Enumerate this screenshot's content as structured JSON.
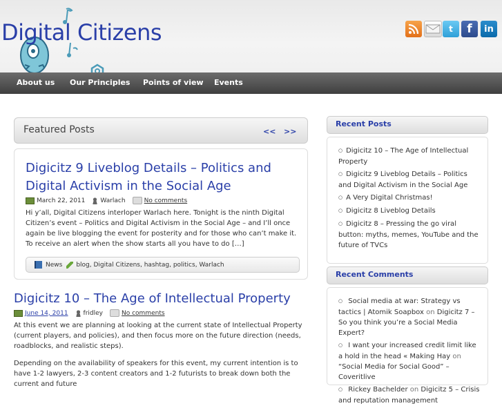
{
  "site": {
    "title": "Digital Citizens"
  },
  "social": [
    {
      "name": "rss-icon",
      "glyph": ""
    },
    {
      "name": "email-icon",
      "glyph": ""
    },
    {
      "name": "twitter-icon",
      "glyph": "t"
    },
    {
      "name": "facebook-icon",
      "glyph": "f"
    },
    {
      "name": "linkedin-icon",
      "glyph": "in"
    }
  ],
  "nav": [
    "About us",
    "Our Principles",
    "Points of view",
    "Events"
  ],
  "featured": {
    "heading": "Featured Posts",
    "prev": "<<",
    "next": ">>",
    "post": {
      "title": "Digicitz 9 Liveblog Details – Politics and Digital Activism in the Social Age",
      "date": "March 22, 2011",
      "author": "Warlach",
      "comments": "No comments",
      "excerpt": "Hi y’all, Digital Citizens interloper Warlach here. Tonight is the ninth Digital Citizen’s event – Politics and Digital Activism in the Social Age – and I’ll once again be live blogging the event for posterity and for those who can’t make it. To receive an alert when the show starts all you have to do […]",
      "category": "News",
      "tags": "blog, Digital Citizens, hashtag, politics, Warlach"
    }
  },
  "post2": {
    "title": "Digicitz 10 – The Age of Intellectual Property",
    "date": "June 14, 2011",
    "author": "fridley",
    "comments": "No comments",
    "para1": "At this event we are planning at looking at the current state of Intellectual Property (current players, and policies), and then focus more on the future direction (needs, roadblocks, and realistic steps).",
    "para2": "Depending on the availability of speakers for this event, my current intention is to have 1-2 lawyers, 2-3 content creators and 1-2 futurists to break down both the current and future"
  },
  "recent_posts": {
    "heading": "Recent Posts",
    "items": [
      "Digicitz 10 – The Age of Intellectual Property",
      "Digicitz 9 Liveblog Details – Politics and Digital Activism in the Social Age",
      "A Very Digital Christmas!",
      "Digicitz 8 Liveblog Details",
      "Digicitz 8 – Pressing the go viral button: myths, memes, YouTube and the future of TVCs"
    ]
  },
  "recent_comments": {
    "heading": "Recent Comments",
    "items": [
      {
        "author": "Social media at war: Strategy vs tactics | Atomik Soapbox",
        "on": "on",
        "post": "Digicitz 7 – So you think you’re a Social Media Expert?"
      },
      {
        "author": "I want your increased credit limit like a hold in the head « Making Hay",
        "on": "on",
        "post": "“Social Media for Social Good” – Coveritlive"
      },
      {
        "author": "Rickey Bachelder",
        "on": "on",
        "post": "Digicitz 5 – Crisis and reputation management"
      }
    ]
  },
  "colors": {
    "accent": "#2a3fa8",
    "nav_bg": "#4f4f4f"
  }
}
